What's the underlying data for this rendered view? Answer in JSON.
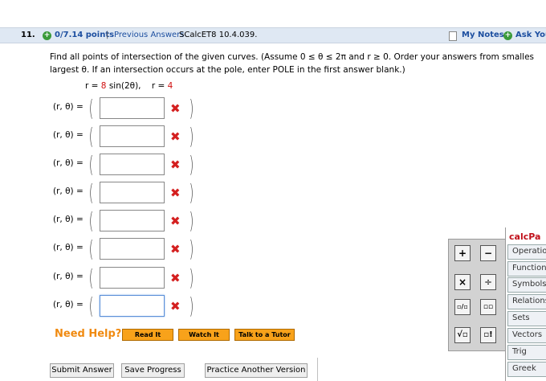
{
  "question": {
    "number": "11.",
    "points": "0/7.14 points",
    "separator": "|",
    "previous_answers": "Previous Answers",
    "reference": "SCalcET8 10.4.039.",
    "my_notes": "My Notes",
    "ask_your": "Ask You"
  },
  "prompt": {
    "line1": "Find all points of intersection of the given curves. (Assume  0 ≤ θ ≤ 2π  and  r ≥ 0.  Order your answers from smalles",
    "line2": "largest θ. If an intersection occurs at the pole, enter POLE in the first answer blank.)",
    "curve1_prefix": "r = ",
    "curve1_coef": "8",
    "curve1_rest": " sin(2θ),",
    "curve2_prefix": "r = ",
    "curve2_value": "4"
  },
  "answer_rows": [
    {
      "label": "(r, θ)  =",
      "value": "",
      "status": "✖"
    },
    {
      "label": "(r, θ)  =",
      "value": "",
      "status": "✖"
    },
    {
      "label": "(r, θ)  =",
      "value": "",
      "status": "✖"
    },
    {
      "label": "(r, θ)  =",
      "value": "",
      "status": "✖"
    },
    {
      "label": "(r, θ)  =",
      "value": "",
      "status": "✖"
    },
    {
      "label": "(r, θ)  =",
      "value": "",
      "status": "✖"
    },
    {
      "label": "(r, θ)  =",
      "value": "",
      "status": "✖"
    },
    {
      "label": "(r, θ)  =",
      "value": "",
      "status": "✖"
    }
  ],
  "help": {
    "title": "Need Help?",
    "read_it": "Read It",
    "watch_it": "Watch It",
    "talk_to_tutor": "Talk to a Tutor"
  },
  "actions": {
    "submit": "Submit Answer",
    "save": "Save Progress",
    "practice": "Practice Another Version"
  },
  "calcpad": {
    "title": "calcPa",
    "keys": [
      "+",
      "−",
      "×",
      "÷",
      "▫/▫",
      "▫▫",
      "√▫",
      "▫!"
    ],
    "menu": [
      "Operation",
      "Functions",
      "Symbols",
      "Relations",
      "Sets",
      "Vectors",
      "Trig",
      "Greek"
    ]
  },
  "colors": {
    "accent_blue": "#1d4fa0",
    "error_red": "#d42020",
    "help_orange": "#f08a10",
    "button_orange": "#f8a21a"
  }
}
